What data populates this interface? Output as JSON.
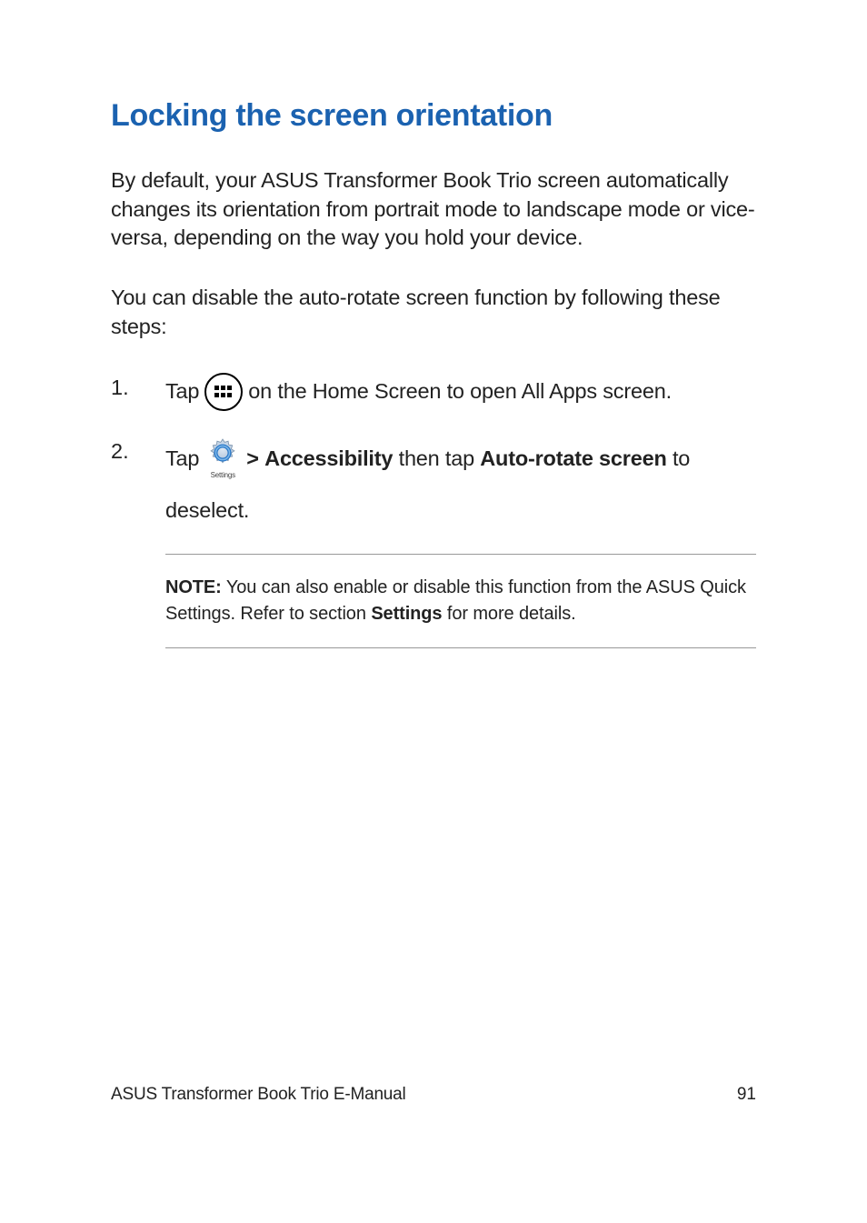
{
  "heading": "Locking the screen orientation",
  "para1": "By default, your ASUS Transformer Book Trio screen automatically changes its orientation from portrait mode to landscape mode or vice-versa, depending on the way you hold your device.",
  "para2": "You can disable the auto-rotate screen function by following these steps:",
  "steps": {
    "s1": {
      "num": "1.",
      "pre": "Tap",
      "post": "on the Home Screen to open All Apps screen."
    },
    "s2": {
      "num": "2.",
      "pre": "Tap",
      "iconCaption": "Settings",
      "gt": ">",
      "bold1": "Accessibility",
      "mid": " then tap ",
      "bold2": "Auto-rotate screen",
      "post": " to",
      "line2": "deselect."
    }
  },
  "note": {
    "label": "NOTE:",
    "text1": "  You can also enable or disable this function from the ASUS Quick Settings. Refer to section ",
    "bold": "Settings",
    "text2": " for more details."
  },
  "footer": {
    "title": "ASUS Transformer Book Trio E-Manual",
    "page": "91"
  }
}
